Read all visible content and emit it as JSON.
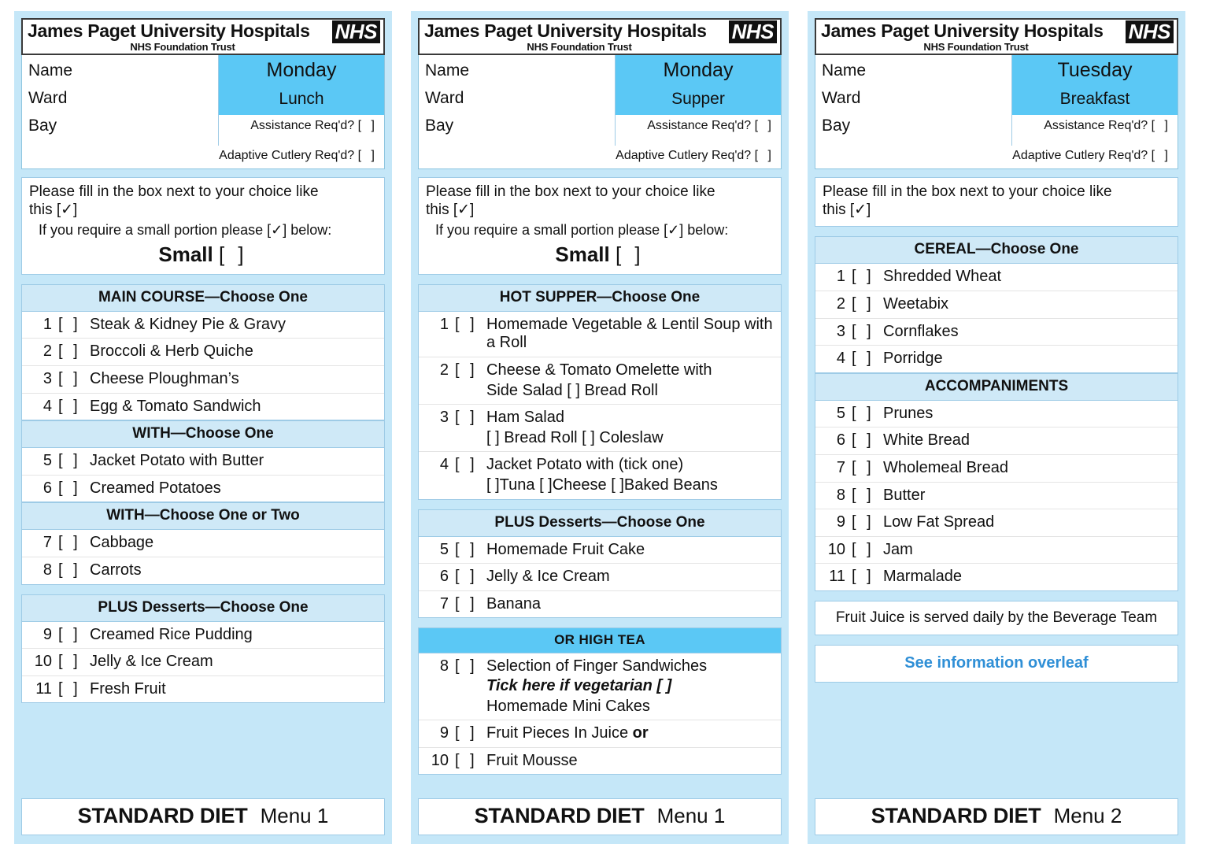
{
  "colors": {
    "card_background": "#c5e7f8",
    "day_banner": "#5bc8f5",
    "section_header": "#cfe9f7",
    "strong_header": "#5bc8f5",
    "overleaf_link": "#2f8fd6"
  },
  "brand": {
    "name": "James Paget University Hospitals",
    "logo": "NHS",
    "subtitle": "NHS Foundation Trust"
  },
  "labels": {
    "name": "Name",
    "ward": "Ward",
    "bay": "Bay",
    "assistance": "Assistance Req'd?",
    "adaptive_cutlery": "Adaptive Cutlery Req'd?",
    "checkbox": "[   ]",
    "ticked_checkbox": "[✓]",
    "instruction_line1": "Please fill in the box next to your choice like",
    "instruction_line2_prefix": "this",
    "small_portion_line": "If you require a small portion please [✓] below:",
    "small_label": "Small",
    "small_box": "[   ]",
    "diet": "STANDARD DIET"
  },
  "cards": [
    {
      "day": "Monday",
      "meal": "Lunch",
      "has_small_portion": true,
      "menu_number": "Menu 1",
      "sections": [
        {
          "title": "MAIN COURSE—Choose One",
          "style": "light",
          "items": [
            {
              "num": "1",
              "text": "Steak & Kidney Pie & Gravy"
            },
            {
              "num": "2",
              "text": "Broccoli & Herb Quiche"
            },
            {
              "num": "3",
              "text": "Cheese Ploughman’s"
            },
            {
              "num": "4",
              "text": "Egg & Tomato Sandwich"
            }
          ]
        },
        {
          "title": "WITH—Choose One",
          "style": "light",
          "tight": true,
          "items": [
            {
              "num": "5",
              "text": "Jacket Potato with Butter"
            },
            {
              "num": "6",
              "text": "Creamed Potatoes"
            }
          ]
        },
        {
          "title": "WITH—Choose One or Two",
          "style": "light",
          "tight": true,
          "items": [
            {
              "num": "7",
              "text": "Cabbage"
            },
            {
              "num": "8",
              "text": "Carrots"
            }
          ]
        },
        {
          "title": "PLUS Desserts—Choose One",
          "style": "light",
          "items": [
            {
              "num": "9",
              "text": "Creamed Rice Pudding"
            },
            {
              "num": "10",
              "text": "Jelly & Ice Cream"
            },
            {
              "num": "11",
              "text": "Fresh Fruit"
            }
          ]
        }
      ],
      "notes": []
    },
    {
      "day": "Monday",
      "meal": "Supper",
      "has_small_portion": true,
      "menu_number": "Menu 1",
      "sections": [
        {
          "title": "HOT SUPPER—Choose One",
          "style": "light",
          "items": [
            {
              "num": "1",
              "text": "Homemade Vegetable & Lentil Soup with a Roll"
            },
            {
              "num": "2",
              "text": "Cheese & Tomato Omelette with",
              "sub": "Side Salad    [   ] Bread Roll"
            },
            {
              "num": "3",
              "text": "Ham Salad",
              "sub": "[   ] Bread Roll   [   ] Coleslaw"
            },
            {
              "num": "4",
              "text": "Jacket Potato with (tick one)",
              "sub": "[  ]Tuna [  ]Cheese [  ]Baked Beans"
            }
          ]
        },
        {
          "title": "PLUS Desserts—Choose One",
          "style": "light",
          "items": [
            {
              "num": "5",
              "text": "Homemade Fruit Cake"
            },
            {
              "num": "6",
              "text": "Jelly & Ice Cream"
            },
            {
              "num": "7",
              "text": "Banana"
            }
          ]
        },
        {
          "title": "OR HIGH TEA",
          "style": "strong",
          "items": [
            {
              "num": "8",
              "text": "Selection of Finger Sandwiches",
              "veg": "Tick here if vegetarian [   ]",
              "sub": "Homemade Mini Cakes"
            },
            {
              "num": "9",
              "text": "Fruit Pieces In Juice ",
              "bold_suffix": "or"
            },
            {
              "num": "10",
              "text": "Fruit Mousse"
            }
          ]
        }
      ],
      "notes": []
    },
    {
      "day": "Tuesday",
      "meal": "Breakfast",
      "has_small_portion": false,
      "menu_number": "Menu 2",
      "sections": [
        {
          "title": "CEREAL—Choose One",
          "style": "light",
          "items": [
            {
              "num": "1",
              "text": "Shredded Wheat"
            },
            {
              "num": "2",
              "text": "Weetabix"
            },
            {
              "num": "3",
              "text": "Cornflakes"
            },
            {
              "num": "4",
              "text": "Porridge"
            }
          ]
        },
        {
          "title": "ACCOMPANIMENTS",
          "style": "light",
          "tight": true,
          "items": [
            {
              "num": "5",
              "text": "Prunes"
            },
            {
              "num": "6",
              "text": "White Bread"
            },
            {
              "num": "7",
              "text": "Wholemeal Bread"
            },
            {
              "num": "8",
              "text": "Butter"
            },
            {
              "num": "9",
              "text": "Low Fat Spread"
            },
            {
              "num": "10",
              "text": "Jam"
            },
            {
              "num": "11",
              "text": "Marmalade"
            }
          ]
        }
      ],
      "notes": [
        {
          "type": "plain",
          "text": "Fruit Juice is served daily by the Beverage Team"
        },
        {
          "type": "link",
          "text": "See information overleaf"
        }
      ]
    }
  ]
}
